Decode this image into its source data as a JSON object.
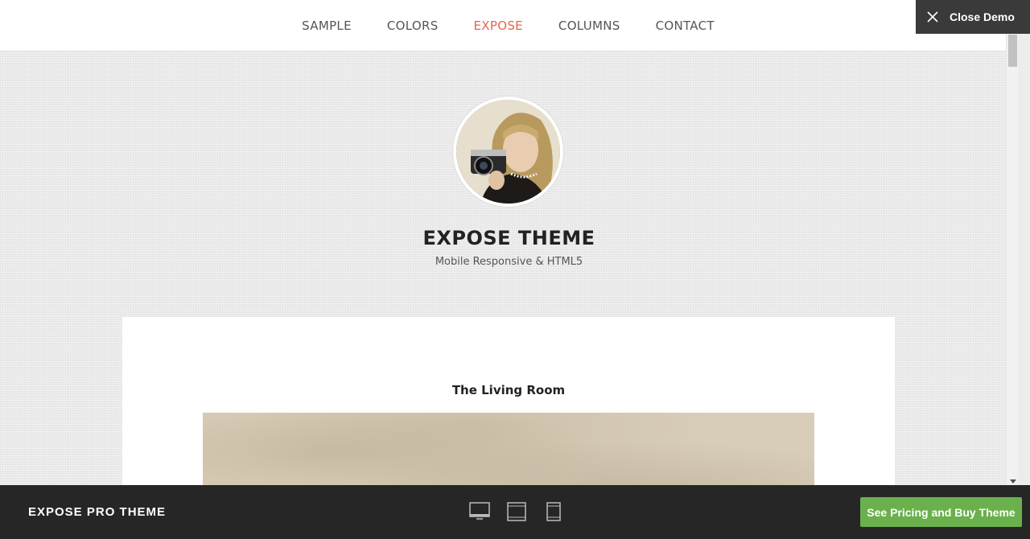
{
  "nav": {
    "items": [
      {
        "label": "SAMPLE"
      },
      {
        "label": "COLORS"
      },
      {
        "label": "EXPOSE"
      },
      {
        "label": "COLUMNS"
      },
      {
        "label": "CONTACT"
      }
    ],
    "active_index": 2
  },
  "close_demo": {
    "label": "Close Demo",
    "icon": "close-icon"
  },
  "hero": {
    "title": "EXPOSE THEME",
    "subtitle": "Mobile Responsive & HTML5"
  },
  "post": {
    "title": "The Living Room"
  },
  "bottom_bar": {
    "brand": "EXPOSE PRO THEME",
    "devices": [
      "desktop-icon",
      "tablet-icon",
      "mobile-icon"
    ],
    "buy_label": "See Pricing and Buy Theme"
  },
  "colors": {
    "accent": "#e8634a",
    "buy_button": "#6ab04c",
    "bottom_bar": "#262626",
    "close_demo": "#3a3a3a"
  }
}
